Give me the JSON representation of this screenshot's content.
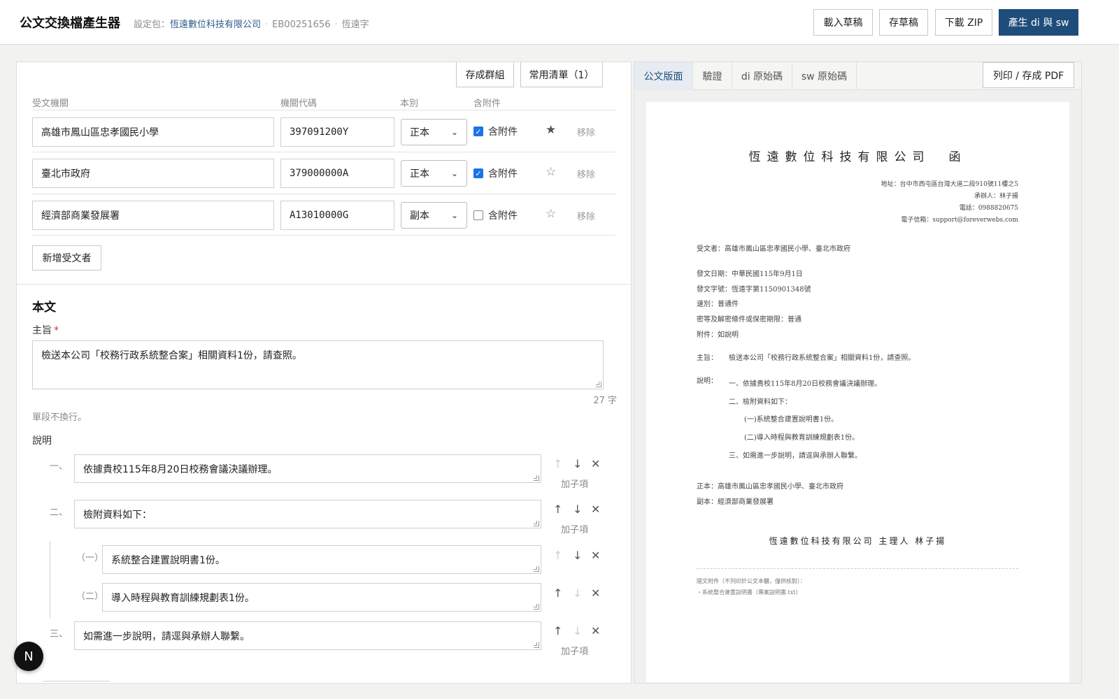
{
  "header": {
    "title": "公文交換檔產生器",
    "meta_prefix": "設定包：",
    "company": "恆遠數位科技有限公司",
    "code": "EB00251656",
    "word": "恆遠字",
    "buttons": {
      "load_draft": "載入草稿",
      "save_draft": "存草稿",
      "download_zip": "下載 ZIP",
      "generate": "產生 di 與 sw"
    },
    "primary_color": "#1f4d7a"
  },
  "recipients": {
    "save_group": "存成群組",
    "common_list": "常用清單（1）",
    "columns": [
      "受文機關",
      "機關代碼",
      "本別",
      "含附件"
    ],
    "attach_label": "含附件",
    "remove_label": "移除",
    "rows": [
      {
        "org": "高雄市鳳山區忠孝國民小學",
        "code": "397091200Y",
        "copy": "正本",
        "attach": true,
        "starred": true
      },
      {
        "org": "臺北市政府",
        "code": "379000000A",
        "copy": "正本",
        "attach": true,
        "starred": false
      },
      {
        "org": "經濟部商業發展署",
        "code": "A13010000G",
        "copy": "副本",
        "attach": false,
        "starred": false
      }
    ],
    "add_button": "新增受文者"
  },
  "body": {
    "section_title": "本文",
    "subject_label": "主旨",
    "required_mark": "*",
    "subject_value": "檢送本公司「校務行政系統整合案」相關資料1份，請查照。",
    "char_count": "27 字",
    "hint": "單段不換行。",
    "explain_label": "說明",
    "add_sub": "加子項",
    "items": [
      {
        "num": "一、",
        "text": "依據貴校115年8月20日校務會議決議辦理。"
      },
      {
        "num": "二、",
        "text": "檢附資料如下："
      },
      {
        "num": "（一）",
        "text": "系統整合建置說明書1份。"
      },
      {
        "num": "（二）",
        "text": "導入時程與教育訓練規劃表1份。"
      },
      {
        "num": "三、",
        "text": "如需進一步說明，請逕與承辦人聯繫。"
      }
    ]
  },
  "preview": {
    "tabs": [
      "公文版面",
      "驗證",
      "di 原始碼",
      "sw 原始碼"
    ],
    "print_button": "列印 / 存成 PDF",
    "doc": {
      "title": "恆遠數位科技有限公司　函",
      "address": "地址：台中市西屯區台灣大道二段910號11樓之5",
      "handler": "承辦人：林子揚",
      "phone": "電話：0988820675",
      "email": "電子信箱：support@foreverwebs.com",
      "receiver": "受文者：高雄市鳳山區忠孝國民小學、臺北市政府",
      "date": "發文日期：中華民國115年9月1日",
      "number": "發文字號：恆遠字第1150901348號",
      "speed": "速別：普通件",
      "secret": "密等及解密條件或保密期限：普通",
      "attachment": "附件：如說明",
      "subject_label": "主旨：",
      "subject": "檢送本公司「校務行政系統整合案」相關資料1份，請查照。",
      "explain_label": "說明：",
      "e1": "一、依據貴校115年8月20日校務會議決議辦理。",
      "e2": "二、檢附資料如下：",
      "e2a": "(一)系統整合建置說明書1份。",
      "e2b": "(二)導入時程與教育訓練規劃表1份。",
      "e3": "三、如需進一步說明，請逕與承辦人聯繫。",
      "main_copy": "正本：高雄市鳳山區忠孝國民小學、臺北市政府",
      "cc_copy": "副本：經濟部商業發展署",
      "signature": "恆遠數位科技有限公司 主理人 林子揚",
      "att_note": "隨文附件（不列印於公文本體，僅供核對）：",
      "att_item": "・系統整合建置說明書（專案說明書.txt）"
    }
  },
  "badge": "N"
}
